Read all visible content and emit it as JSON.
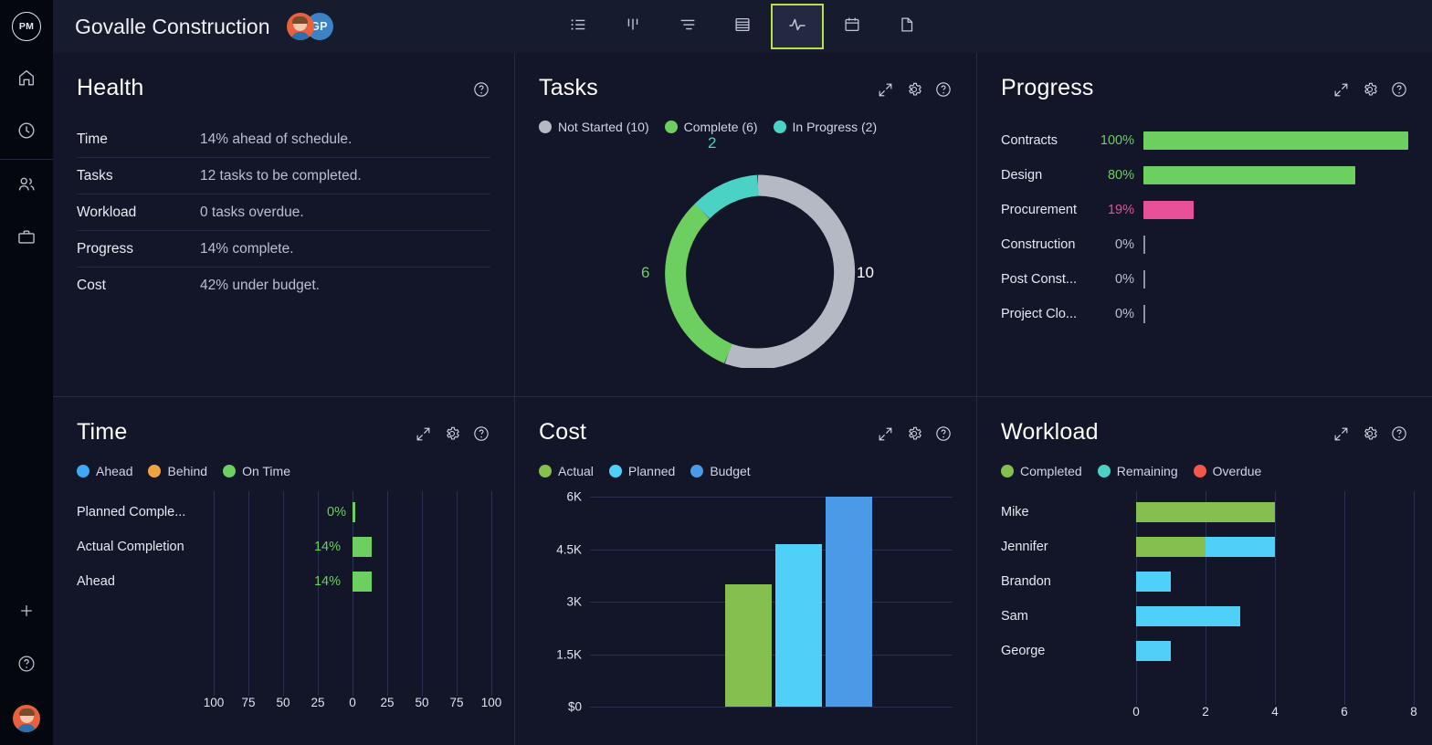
{
  "rail": {
    "logo_text": "PM",
    "items": [
      {
        "name": "home-icon",
        "label": "Home"
      },
      {
        "name": "clock-icon",
        "label": "Recent"
      },
      {
        "name": "people-icon",
        "label": "Team"
      },
      {
        "name": "briefcase-icon",
        "label": "Projects"
      }
    ],
    "bottom_items": [
      {
        "name": "plus-icon",
        "label": "Add"
      },
      {
        "name": "help-circle-icon",
        "label": "Help"
      },
      {
        "name": "user-avatar",
        "label": "Account"
      }
    ]
  },
  "header": {
    "project_title": "Govalle Construction",
    "avatars": [
      {
        "type": "photo",
        "label": ""
      },
      {
        "type": "initials",
        "label": "GP"
      }
    ],
    "views": [
      {
        "name": "list-view",
        "icon": "list-icon",
        "active": false
      },
      {
        "name": "board-view",
        "icon": "board-icon",
        "active": false
      },
      {
        "name": "gantt-view",
        "icon": "gantt-icon",
        "active": false
      },
      {
        "name": "sheet-view",
        "icon": "sheet-icon",
        "active": false
      },
      {
        "name": "dashboard-view",
        "icon": "activity-icon",
        "active": true
      },
      {
        "name": "calendar-view",
        "icon": "calendar-icon",
        "active": false
      },
      {
        "name": "document-view",
        "icon": "document-icon",
        "active": false
      }
    ]
  },
  "colors": {
    "green": "#6ccf5f",
    "olive": "#84bf4f",
    "cyan": "#4fd0f9",
    "teal": "#4ad3c4",
    "blue": "#4a9ae8",
    "gray": "#b4b9c4",
    "pink": "#e8509a",
    "orange": "#f0a33c",
    "red": "#f3564a",
    "accent": "#b9e048"
  },
  "panels": {
    "health": {
      "title": "Health",
      "icons": [
        "help-circle-icon"
      ],
      "rows": [
        {
          "label": "Time",
          "value": "14% ahead of schedule."
        },
        {
          "label": "Tasks",
          "value": "12 tasks to be completed."
        },
        {
          "label": "Workload",
          "value": "0 tasks overdue."
        },
        {
          "label": "Progress",
          "value": "14% complete."
        },
        {
          "label": "Cost",
          "value": "42% under budget."
        }
      ]
    },
    "tasks": {
      "title": "Tasks",
      "icons": [
        "expand-icon",
        "gear-icon",
        "help-circle-icon"
      ],
      "legend": [
        {
          "label": "Not Started (10)",
          "color": "#b4b9c4"
        },
        {
          "label": "Complete (6)",
          "color": "#6ccf5f"
        },
        {
          "label": "In Progress (2)",
          "color": "#4ad3c4"
        }
      ],
      "chart_data": {
        "type": "pie",
        "title": "Tasks",
        "labels": [
          "Not Started",
          "Complete",
          "In Progress"
        ],
        "values": [
          10,
          6,
          2
        ],
        "colors": [
          "#b4b9c4",
          "#6ccf5f",
          "#4ad3c4"
        ],
        "total": 18,
        "data_labels": [
          "10",
          "6",
          "2"
        ],
        "legend_position": "top"
      }
    },
    "progress": {
      "title": "Progress",
      "icons": [
        "expand-icon",
        "gear-icon",
        "help-circle-icon"
      ],
      "chart_data": {
        "type": "bar",
        "title": "Progress",
        "orientation": "horizontal",
        "categories": [
          "Contracts",
          "Design",
          "Procurement",
          "Construction",
          "Post Const...",
          "Project Clo..."
        ],
        "values": [
          100,
          80,
          19,
          0,
          0,
          0
        ],
        "data_labels": [
          "100%",
          "80%",
          "19%",
          "0%",
          "0%",
          "0%"
        ],
        "bar_colors": [
          "#6ccf5f",
          "#6ccf5f",
          "#e8509a",
          "#8b93a8",
          "#8b93a8",
          "#8b93a8"
        ],
        "label_colors": [
          "#6ccf5f",
          "#6ccf5f",
          "#e8509a",
          "#b9c0d2",
          "#b9c0d2",
          "#b9c0d2"
        ],
        "xlim": [
          0,
          100
        ],
        "ylabel": "",
        "xlabel": "",
        "grid": false
      }
    },
    "time": {
      "title": "Time",
      "icons": [
        "expand-icon",
        "gear-icon",
        "help-circle-icon"
      ],
      "legend": [
        {
          "label": "Ahead",
          "color": "#3fa9f5"
        },
        {
          "label": "Behind",
          "color": "#f0a33c"
        },
        {
          "label": "On Time",
          "color": "#6ccf5f"
        }
      ],
      "chart_data": {
        "type": "bar",
        "title": "Time",
        "orientation": "horizontal-diverging",
        "categories": [
          "Planned Comple...",
          "Actual Completion",
          "Ahead"
        ],
        "values": [
          0,
          14,
          14
        ],
        "data_labels": [
          "0%",
          "14%",
          "14%"
        ],
        "bar_colors": [
          "#6ccf5f",
          "#6ccf5f",
          "#6ccf5f"
        ],
        "xticks": [
          "100",
          "75",
          "50",
          "25",
          "0",
          "25",
          "50",
          "75",
          "100"
        ],
        "xlim": [
          -100,
          100
        ],
        "grid": true
      }
    },
    "cost": {
      "title": "Cost",
      "icons": [
        "expand-icon",
        "gear-icon",
        "help-circle-icon"
      ],
      "legend": [
        {
          "label": "Actual",
          "color": "#84bf4f"
        },
        {
          "label": "Planned",
          "color": "#4fd0f9"
        },
        {
          "label": "Budget",
          "color": "#4a9ae8"
        }
      ],
      "chart_data": {
        "type": "bar",
        "title": "Cost",
        "categories": [
          "Actual",
          "Planned",
          "Budget"
        ],
        "values": [
          3500,
          4650,
          6000
        ],
        "bar_colors": [
          "#84bf4f",
          "#4fd0f9",
          "#4a9ae8"
        ],
        "yticks": [
          "$0",
          "1.5K",
          "3K",
          "4.5K",
          "6K"
        ],
        "ytick_values": [
          0,
          1500,
          3000,
          4500,
          6000
        ],
        "ylim": [
          0,
          6000
        ],
        "xlabel": "",
        "ylabel": "",
        "grid": true
      }
    },
    "workload": {
      "title": "Workload",
      "icons": [
        "expand-icon",
        "gear-icon",
        "help-circle-icon"
      ],
      "legend": [
        {
          "label": "Completed",
          "color": "#84bf4f"
        },
        {
          "label": "Remaining",
          "color": "#4fd0f9"
        },
        {
          "label": "Overdue",
          "color": "#f3564a"
        }
      ],
      "chart_data": {
        "type": "bar",
        "title": "Workload",
        "orientation": "horizontal-stacked",
        "categories": [
          "Mike",
          "Jennifer",
          "Brandon",
          "Sam",
          "George"
        ],
        "series": [
          {
            "name": "Completed",
            "color": "#84bf4f",
            "values": [
              4,
              2,
              0,
              0,
              0
            ]
          },
          {
            "name": "Remaining",
            "color": "#4fd0f9",
            "values": [
              0,
              2,
              1,
              3,
              1
            ]
          },
          {
            "name": "Overdue",
            "color": "#f3564a",
            "values": [
              0,
              0,
              0,
              0,
              0
            ]
          }
        ],
        "xticks": [
          "0",
          "2",
          "4",
          "6",
          "8"
        ],
        "xlim": [
          0,
          8
        ],
        "grid": true
      }
    }
  }
}
